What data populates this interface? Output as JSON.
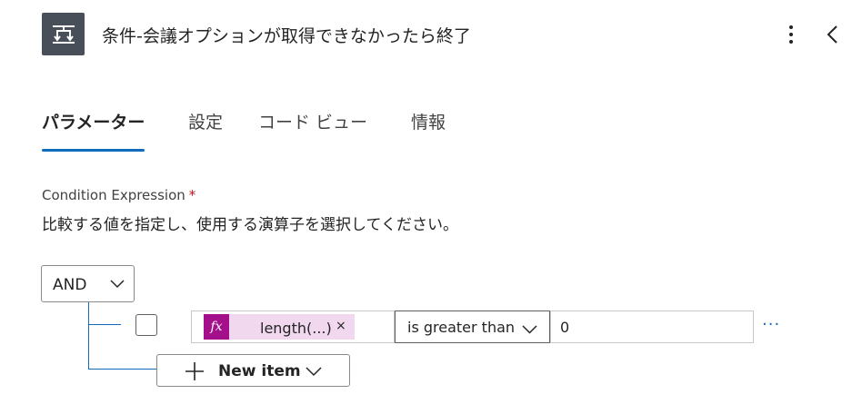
{
  "header": {
    "title": "条件-会議オプションが取得できなかったら終了",
    "app_icon": "condition-icon",
    "more_icon": "more-vertical-icon",
    "collapse_icon": "chevron-left-icon"
  },
  "tabs": [
    {
      "label": "パラメーター",
      "active": true
    },
    {
      "label": "設定",
      "active": false
    },
    {
      "label": "コード ビュー",
      "active": false
    },
    {
      "label": "情報",
      "active": false
    }
  ],
  "condition": {
    "label": "Condition Expression",
    "required_mark": "*",
    "description": "比較する値を指定し、使用する演算子を選択してください。",
    "group_operator": "AND",
    "row": {
      "left_token": {
        "icon": "fx-icon",
        "icon_text": "fx",
        "label": "length(...)",
        "remove": "×"
      },
      "operator": "is greater than",
      "right_value": "0",
      "more_label": "···"
    },
    "new_item_label": "New item"
  },
  "colors": {
    "accent": "#0f6cbd",
    "token_bg": "#f2d8ef",
    "fx_bg": "#a4108c",
    "required": "#c50f1f",
    "icon_bg": "#484f58"
  }
}
